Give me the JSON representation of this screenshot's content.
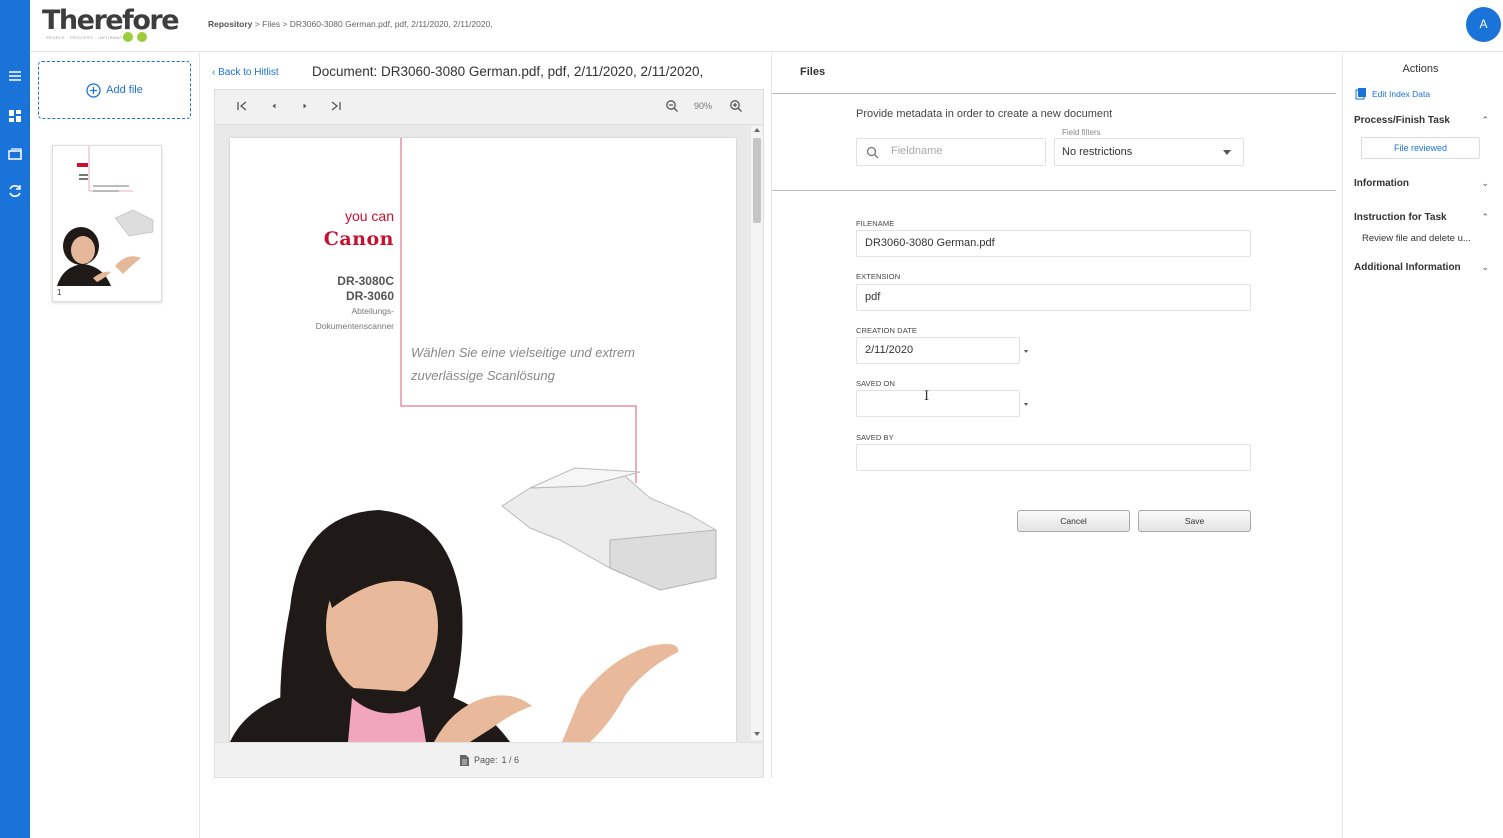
{
  "app": {
    "logo_text": "Therefore",
    "tagline": "PEOPLE · PROCESS · INFORMATION",
    "avatar_letter": "A",
    "brand_color": "#1a73d9"
  },
  "breadcrumb": {
    "items": [
      "Repository",
      "Files",
      "DR3060-3080 German.pdf, pdf, 2/11/2020, 2/11/2020,"
    ],
    "separator": ">"
  },
  "thumbnails": {
    "add_file_label": "Add file",
    "pages": [
      {
        "number": "1"
      }
    ]
  },
  "document": {
    "back_label": "Back to Hitlist",
    "title": "Document: DR3060-3080 German.pdf, pdf, 2/11/2020, 2/11/2020,"
  },
  "viewer": {
    "zoom": "90%",
    "page_label": "Page:",
    "page_indicator": "1 / 6",
    "icons": [
      "first-page-icon",
      "previous-page-icon",
      "next-page-icon",
      "last-page-icon",
      "zoom-out-icon",
      "zoom-in-icon",
      "document-icon"
    ],
    "page_content": {
      "you_can": "you can",
      "brand": "Canon",
      "model_1": "DR-3080C",
      "model_2": "DR-3060",
      "desc_1": "Abteilungs-",
      "desc_2": "Dokumentenscanner",
      "slogan_1": "Wählen Sie eine vielseitige und extrem",
      "slogan_2": "zuverlässige Scanlösung"
    }
  },
  "files_panel": {
    "title": "Files",
    "intro": "Provide metadata in order to create a new document",
    "search_placeholder": "Fieldname",
    "field_filters_label": "Field filters",
    "field_filters_value": "No restrictions",
    "fields": [
      {
        "label": "FILENAME",
        "value": "DR3060-3080 German.pdf"
      },
      {
        "label": "EXTENSION",
        "value": "pdf"
      },
      {
        "label": "CREATION DATE",
        "value": "2/11/2020"
      },
      {
        "label": "SAVED ON",
        "value": ""
      },
      {
        "label": "SAVED BY",
        "value": ""
      }
    ],
    "cancel_label": "Cancel",
    "save_label": "Save"
  },
  "actions_panel": {
    "title": "Actions",
    "edit_index_label": "Edit Index Data",
    "sections": [
      {
        "title": "Process/Finish Task",
        "expanded": true
      },
      {
        "title": "Information",
        "expanded": false
      },
      {
        "title": "Instruction for Task",
        "expanded": true
      },
      {
        "title": "Additional Information",
        "expanded": false
      }
    ],
    "task_button_label": "File reviewed",
    "instruction_text": "Review file and delete u..."
  }
}
